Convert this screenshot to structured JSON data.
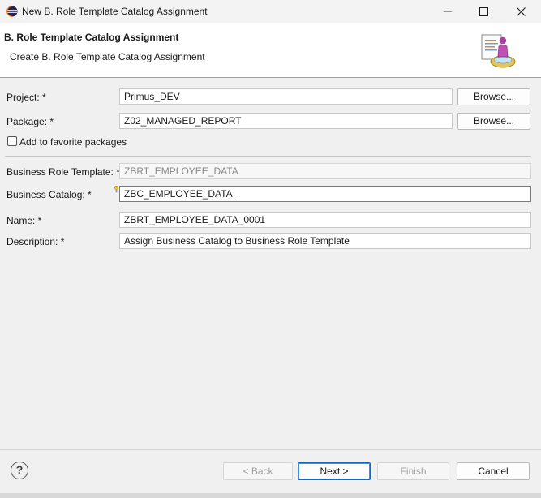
{
  "window": {
    "title": "New B. Role Template Catalog Assignment",
    "minimize_glyph": "—",
    "maximize_glyph": "☐",
    "close_glyph": "✕"
  },
  "header": {
    "title": "B. Role Template Catalog Assignment",
    "subtitle": "Create B. Role Template Catalog Assignment"
  },
  "form": {
    "project": {
      "label": "Project: *",
      "value": "Primus_DEV",
      "browse_label": "Browse..."
    },
    "package": {
      "label": "Package: *",
      "value": "Z02_MANAGED_REPORT",
      "browse_label": "Browse..."
    },
    "favorite": {
      "label": "Add to favorite packages",
      "checked": false
    },
    "role_template": {
      "label": "Business Role Template: *",
      "value": "ZBRT_EMPLOYEE_DATA"
    },
    "catalog": {
      "label": "Business Catalog: *",
      "value": "ZBC_EMPLOYEE_DATA"
    },
    "name": {
      "label": "Name: *",
      "value": "ZBRT_EMPLOYEE_DATA_0001"
    },
    "description": {
      "label": "Description: *",
      "value": "Assign Business Catalog to Business Role Template"
    }
  },
  "footer": {
    "help_glyph": "?",
    "back_label": "< Back",
    "next_label": "Next >",
    "finish_label": "Finish",
    "cancel_label": "Cancel"
  },
  "icons": {
    "app": "eclipse-icon",
    "wizard": "assignment-wizard-icon",
    "help": "help-icon",
    "content_assist": "lightbulb-icon"
  },
  "colors": {
    "default_button_border": "#0f6ac7",
    "header_background": "#ffffff",
    "dialog_background": "#f0f0f0"
  }
}
